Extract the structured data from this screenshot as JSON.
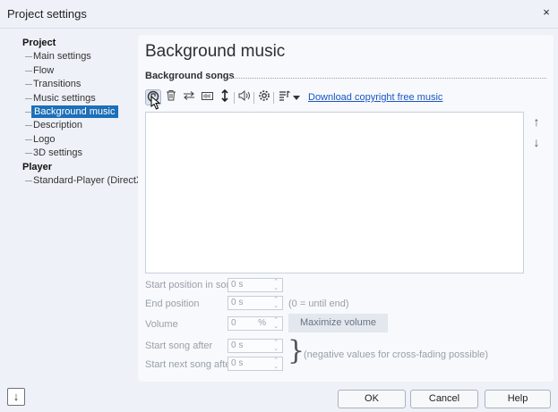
{
  "window": {
    "title": "Project settings",
    "close_glyph": "×"
  },
  "tree": {
    "project_label": "Project",
    "project_items": [
      "Main settings",
      "Flow",
      "Transitions",
      "Music settings",
      "Background music",
      "Description",
      "Logo",
      "3D settings"
    ],
    "player_label": "Player",
    "player_items": [
      "Standard-Player (DirectX)"
    ]
  },
  "main": {
    "heading": "Background music",
    "section": "Background songs",
    "toolbar": {
      "icons": [
        "add-song-icon",
        "delete-icon",
        "replace-icon",
        "waveform-icon",
        "split-icon",
        "volume-icon",
        "settings-icon",
        "options-icon",
        "dropdown-icon"
      ],
      "link": "Download copyright free music"
    },
    "move_up_glyph": "↑",
    "move_down_glyph": "↓"
  },
  "fields": {
    "start_position": {
      "label": "Start position in song",
      "value": "0 s"
    },
    "end_position": {
      "label": "End position",
      "value": "0 s",
      "hint": "(0 = until end)"
    },
    "volume": {
      "label": "Volume",
      "value": "0",
      "unit": "%",
      "button": "Maximize volume"
    },
    "start_song_after": {
      "label": "Start song after",
      "value": "0 s"
    },
    "start_next_song_after": {
      "label": "Start next song after",
      "value": "0 s"
    },
    "fade_hint": "(negative values for cross-fading possible)"
  },
  "footer": {
    "ok": "OK",
    "cancel": "Cancel",
    "help": "Help",
    "collapse_glyph": "↓"
  }
}
